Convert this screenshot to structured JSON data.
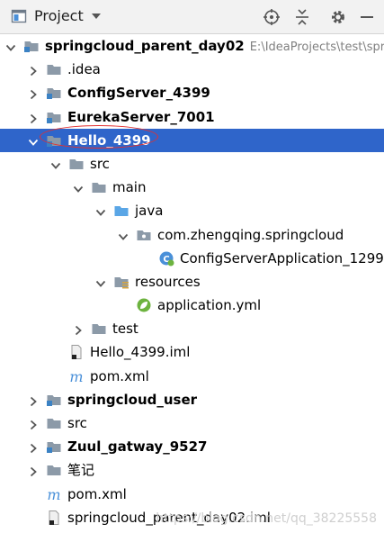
{
  "header": {
    "title": "Project"
  },
  "colors": {
    "selection": "#2f65ca",
    "folder": "#8c9aa8",
    "module_badge": "#3b82c4",
    "source_folder": "#5aa6e6",
    "annotation": "#e23030"
  },
  "tree": [
    {
      "label": "springcloud_parent_day02",
      "path": "E:\\IdeaProjects\\test\\spr",
      "depth": 0,
      "arrow": "down",
      "icon": "module-folder-icon",
      "bold": true
    },
    {
      "label": ".idea",
      "depth": 1,
      "arrow": "right",
      "icon": "folder-icon",
      "bold": false
    },
    {
      "label": "ConfigServer_4399",
      "depth": 1,
      "arrow": "right",
      "icon": "module-folder-icon",
      "bold": true
    },
    {
      "label": "EurekaServer_7001",
      "depth": 1,
      "arrow": "right",
      "icon": "module-folder-icon",
      "bold": true
    },
    {
      "label": "Hello_4399",
      "depth": 1,
      "arrow": "down",
      "icon": "module-folder-icon",
      "bold": true,
      "selected": true
    },
    {
      "label": "src",
      "depth": 2,
      "arrow": "down",
      "icon": "folder-icon",
      "bold": false
    },
    {
      "label": "main",
      "depth": 3,
      "arrow": "down",
      "icon": "folder-icon",
      "bold": false
    },
    {
      "label": "java",
      "depth": 4,
      "arrow": "down",
      "icon": "source-folder-icon",
      "bold": false
    },
    {
      "label": "com.zhengqing.springcloud",
      "depth": 5,
      "arrow": "down",
      "icon": "package-icon",
      "bold": false
    },
    {
      "label": "ConfigServerApplication_1299",
      "depth": 6,
      "arrow": "none",
      "icon": "spring-boot-class-icon",
      "bold": false
    },
    {
      "label": "resources",
      "depth": 4,
      "arrow": "down",
      "icon": "resources-folder-icon",
      "bold": false
    },
    {
      "label": "application.yml",
      "depth": 5,
      "arrow": "none",
      "icon": "spring-leaf-icon",
      "bold": false
    },
    {
      "label": "test",
      "depth": 3,
      "arrow": "right",
      "icon": "folder-icon",
      "bold": false
    },
    {
      "label": "Hello_4399.iml",
      "depth": 2,
      "arrow": "none",
      "icon": "iml-file-icon",
      "bold": false
    },
    {
      "label": "pom.xml",
      "depth": 2,
      "arrow": "none",
      "icon": "maven-icon",
      "bold": false
    },
    {
      "label": "springcloud_user",
      "depth": 1,
      "arrow": "right",
      "icon": "module-folder-icon",
      "bold": true
    },
    {
      "label": "src",
      "depth": 1,
      "arrow": "right",
      "icon": "folder-icon",
      "bold": false
    },
    {
      "label": "Zuul_gatway_9527",
      "depth": 1,
      "arrow": "right",
      "icon": "module-folder-icon",
      "bold": true
    },
    {
      "label": "笔记",
      "depth": 1,
      "arrow": "right",
      "icon": "folder-icon",
      "bold": false
    },
    {
      "label": "pom.xml",
      "depth": 1,
      "arrow": "none",
      "icon": "maven-icon",
      "bold": false
    },
    {
      "label": "springcloud_parent_day02.iml",
      "depth": 1,
      "arrow": "none",
      "icon": "iml-file-icon",
      "bold": false
    }
  ],
  "watermark": "https://blog.csdn.net/qq_38225558"
}
